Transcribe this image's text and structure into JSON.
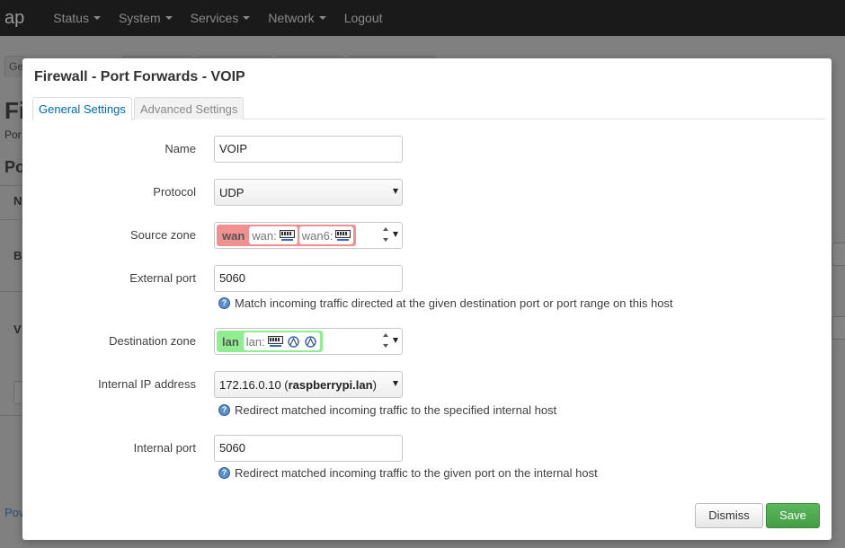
{
  "navbar": {
    "brand": "ap",
    "items": [
      {
        "label": "Status",
        "dropdown": true
      },
      {
        "label": "System",
        "dropdown": true
      },
      {
        "label": "Services",
        "dropdown": true
      },
      {
        "label": "Network",
        "dropdown": true
      },
      {
        "label": "Logout",
        "dropdown": false
      }
    ]
  },
  "background": {
    "tab_first": "Ge",
    "heading_big": "Fi",
    "sub_text": "Por",
    "section_heading": "Po",
    "col_header": "N",
    "row1": "B",
    "row2": "V",
    "footer_link": "Pov"
  },
  "modal": {
    "title": "Firewall - Port Forwards - VOIP",
    "tabs": [
      {
        "label": "General Settings",
        "active": true
      },
      {
        "label": "Advanced Settings",
        "active": false
      }
    ],
    "fields": {
      "name": {
        "label": "Name",
        "value": "VOIP"
      },
      "protocol": {
        "label": "Protocol",
        "value": "UDP"
      },
      "source_zone": {
        "label": "Source zone",
        "zone": "wan",
        "zone_color": "#f09090",
        "interfaces": [
          "wan:",
          "wan6:"
        ]
      },
      "external_port": {
        "label": "External port",
        "value": "5060",
        "help": "Match incoming traffic directed at the given destination port or port range on this host"
      },
      "destination_zone": {
        "label": "Destination zone",
        "zone": "lan",
        "zone_color": "#90ee90",
        "interfaces": [
          "lan:"
        ]
      },
      "internal_ip": {
        "label": "Internal IP address",
        "ip": "172.16.0.10 (",
        "host": "raspberrypi.lan",
        "close": ")",
        "help": "Redirect matched incoming traffic to the specified internal host"
      },
      "internal_port": {
        "label": "Internal port",
        "value": "5060",
        "help": "Redirect matched incoming traffic to the given port on the internal host"
      }
    },
    "buttons": {
      "dismiss": "Dismiss",
      "save": "Save"
    },
    "help_glyph": "?"
  },
  "colors": {
    "accent": "#0069b4",
    "save": "#5cb85c",
    "navbar": "#1a1a1a"
  }
}
